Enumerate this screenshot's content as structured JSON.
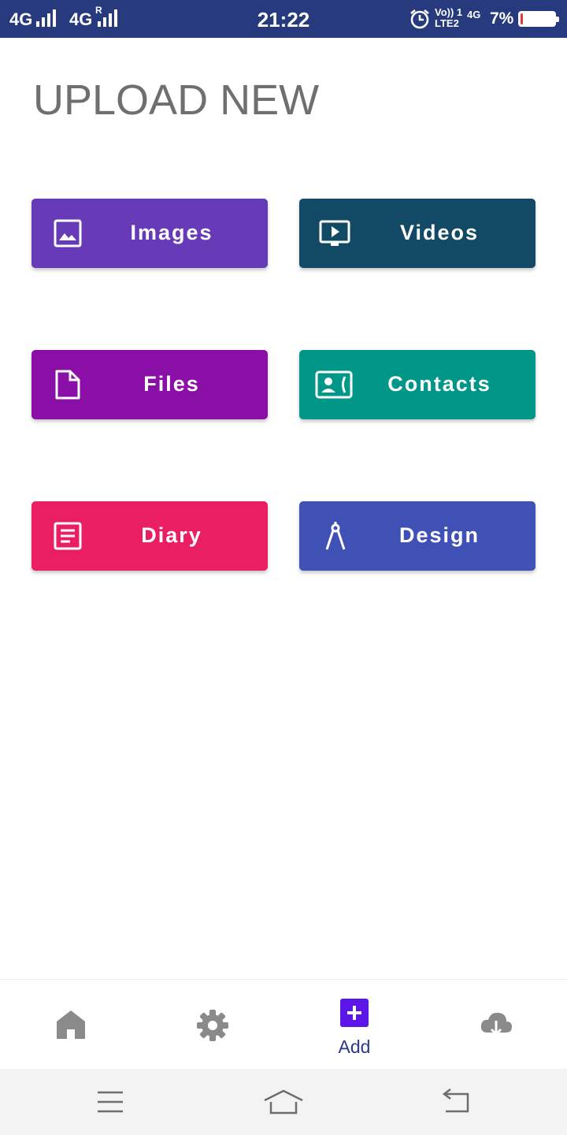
{
  "status_bar": {
    "network1": "4G",
    "network2": "4G",
    "roaming": "R",
    "time": "21:22",
    "volte_line1": "Vo)) 1",
    "volte_line2": "LTE2",
    "network3": "4G",
    "battery_percent_text": "7%",
    "battery_level": 0.07,
    "icons": [
      "signal-icon",
      "signal-icon",
      "alarm-icon",
      "battery-icon"
    ]
  },
  "page": {
    "title": "UPLOAD NEW"
  },
  "tiles": [
    {
      "label": "Images",
      "icon": "image-icon",
      "color": "#673ab7"
    },
    {
      "label": "Videos",
      "icon": "video-icon",
      "color": "#124a66"
    },
    {
      "label": "Files",
      "icon": "file-icon",
      "color": "#8a0fa6"
    },
    {
      "label": "Contacts",
      "icon": "contacts-icon",
      "color": "#009688"
    },
    {
      "label": "Diary",
      "icon": "diary-icon",
      "color": "#e91e63"
    },
    {
      "label": "Design",
      "icon": "compass-icon",
      "color": "#3f51b5"
    }
  ],
  "bottom_nav": {
    "items": [
      {
        "icon": "home-icon",
        "label": ""
      },
      {
        "icon": "gear-icon",
        "label": ""
      },
      {
        "icon": "add-icon",
        "label": "Add",
        "active": true
      },
      {
        "icon": "cloud-download-icon",
        "label": ""
      }
    ],
    "active_color": "#5b16e8",
    "inactive_color": "#8a8a8a"
  },
  "system_nav": {
    "icons": [
      "menu-icon",
      "home-outline-icon",
      "back-icon"
    ]
  }
}
